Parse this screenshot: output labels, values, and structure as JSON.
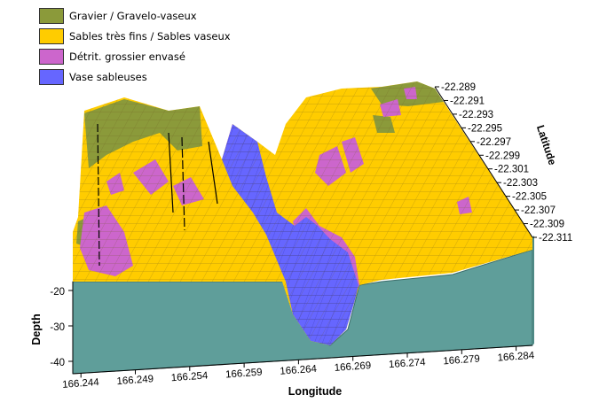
{
  "chart_data": {
    "type": "surface-3d",
    "title": "",
    "xlabel": "Longitude",
    "ylabel": "Latitude",
    "zlabel": "Depth",
    "x_ticks": [
      "166.244",
      "166.249",
      "166.254",
      "166.259",
      "166.264",
      "166.269",
      "166.274",
      "166.279",
      "166.284"
    ],
    "y_ticks": [
      "-22.289",
      "-22.291",
      "-22.293",
      "-22.295",
      "-22.297",
      "-22.299",
      "-22.301",
      "-22.303",
      "-22.305",
      "-22.307",
      "-22.309",
      "-22.311"
    ],
    "z_ticks": [
      "-20",
      "-30",
      "-40"
    ],
    "zlim": [
      -40,
      -20
    ],
    "categories": [
      {
        "name": "Gravier / Gravelo-vaseux",
        "color": "#8b9a3a"
      },
      {
        "name": "Sables très fins / Sables vaseux",
        "color": "#ffcc00"
      },
      {
        "name": "Détrit. grossier envasé",
        "color": "#cc66cc"
      },
      {
        "name": "Vase sableuses",
        "color": "#6666ff"
      }
    ],
    "base_color": "#5f9e9a"
  }
}
